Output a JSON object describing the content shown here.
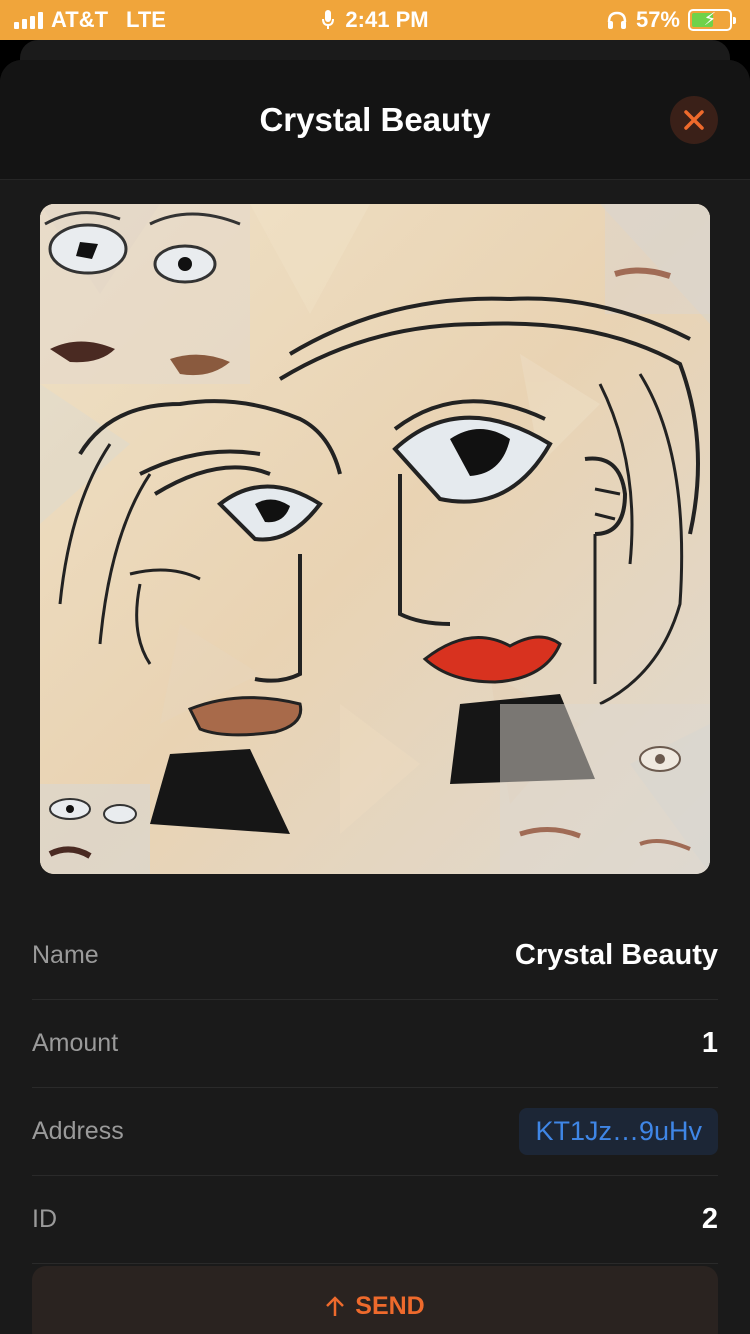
{
  "status_bar": {
    "carrier": "AT&T",
    "network": "LTE",
    "time": "2:41 PM",
    "battery_percent": "57%",
    "battery_level": 0.57,
    "icons": [
      "signal-icon",
      "microphone-icon",
      "headphones-icon",
      "battery-charging-icon"
    ]
  },
  "header": {
    "title": "Crystal Beauty",
    "close_icon": "close-icon"
  },
  "artwork": {
    "subject": "cubist faces portrait",
    "colors": {
      "background": "#ead8bd",
      "lips_red": "#d8321f",
      "lips_brown": "#a86a4a",
      "dark": "#111111"
    }
  },
  "details": [
    {
      "label": "Name",
      "value": "Crystal Beauty"
    },
    {
      "label": "Amount",
      "value": "1"
    },
    {
      "label": "Address",
      "value": "KT1Jz…9uHv"
    },
    {
      "label": "ID",
      "value": "2"
    }
  ],
  "send_button": {
    "label": "SEND",
    "icon": "arrow-up-icon"
  },
  "colors": {
    "accent": "#ee6a2c",
    "status_bar": "#f0a53b",
    "link": "#3f86e6",
    "sheet": "#1a1a1a"
  }
}
